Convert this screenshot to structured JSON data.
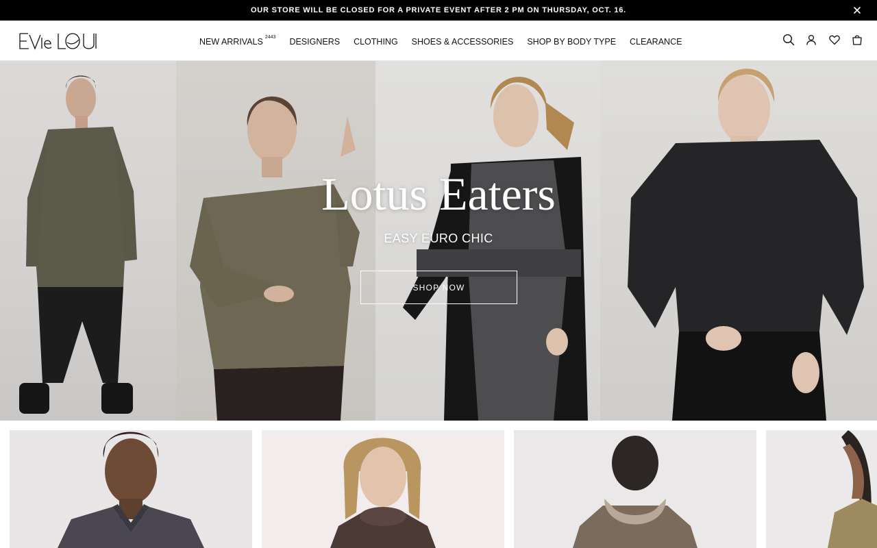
{
  "announcement": {
    "text": "OUR STORE WILL BE CLOSED FOR A PRIVATE EVENT AFTER 2 PM ON THURSDAY, OCT. 16.",
    "close_icon": "close-icon"
  },
  "header": {
    "logo_text": "EVIE LOU",
    "nav": [
      {
        "label": "NEW ARRIVALS",
        "badge": "2443"
      },
      {
        "label": "DESIGNERS"
      },
      {
        "label": "CLOTHING"
      },
      {
        "label": "SHOES & ACCESSORIES"
      },
      {
        "label": "SHOP BY BODY TYPE"
      },
      {
        "label": "CLEARANCE"
      }
    ],
    "icons": [
      "search-icon",
      "account-icon",
      "wishlist-heart-icon",
      "cart-bag-icon"
    ]
  },
  "hero": {
    "title": "Lotus Eaters",
    "subtitle": "EASY EURO CHIC",
    "cta_label": "SHOP NOW"
  },
  "product_tiles": [
    {
      "image": "model-charcoal-button-shirt"
    },
    {
      "image": "model-brown-tie-dye-cowl-top"
    },
    {
      "image": "model-brown-hooded-top-back"
    },
    {
      "image": "model-olive-top-partial"
    }
  ],
  "colors": {
    "announcement_bg": "#000000",
    "header_bg": "#ffffff",
    "text": "#111111",
    "hero_text": "#ffffff"
  }
}
